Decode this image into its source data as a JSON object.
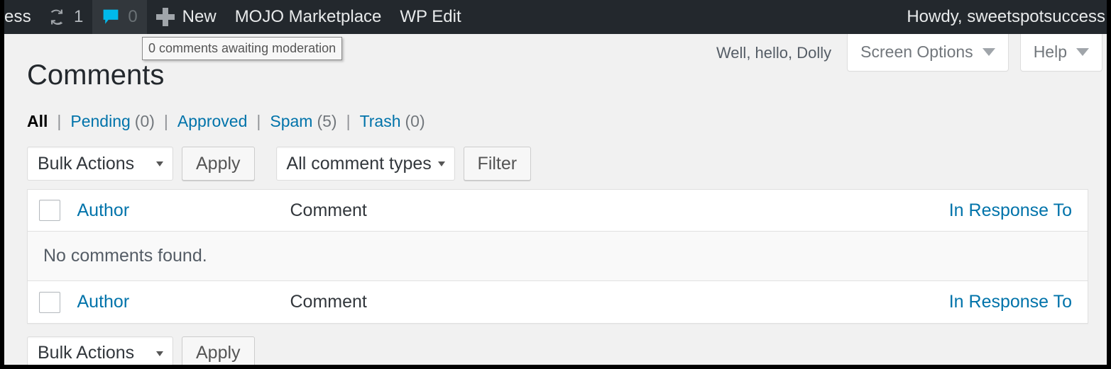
{
  "adminbar": {
    "site_name": "ess",
    "updates": {
      "icon": "update-icon",
      "count": "1"
    },
    "comments": {
      "icon": "comment-bubble-icon",
      "count": "0"
    },
    "new": {
      "icon": "plus-icon",
      "label": "New"
    },
    "mojo_marketplace": "MOJO Marketplace",
    "wp_edit": "WP Edit",
    "howdy": "Howdy, sweetspotsuccess",
    "bubble_color": "#00b9eb",
    "bar_color": "#23282d",
    "hover_color": "#32373c"
  },
  "tooltip": {
    "text": "0 comments awaiting moderation"
  },
  "screen_meta": {
    "dolly": "Well, hello, Dolly",
    "screen_options": "Screen Options",
    "help": "Help"
  },
  "page": {
    "title": "Comments"
  },
  "filters": {
    "items": [
      {
        "label": "All",
        "count": "",
        "current": true
      },
      {
        "label": "Pending",
        "count": "(0)",
        "current": false
      },
      {
        "label": "Approved",
        "count": "",
        "current": false
      },
      {
        "label": "Spam",
        "count": "(5)",
        "current": false
      },
      {
        "label": "Trash",
        "count": "(0)",
        "current": false
      }
    ],
    "separator": "|"
  },
  "tablenav_top": {
    "bulk_actions_value": "Bulk Actions",
    "apply_label": "Apply",
    "comment_types_value": "All comment types",
    "filter_label": "Filter"
  },
  "tablenav_bottom": {
    "bulk_actions_value": "Bulk Actions",
    "apply_label": "Apply"
  },
  "table": {
    "columns": {
      "author": "Author",
      "comment": "Comment",
      "response": "In Response To"
    },
    "no_items": "No comments found."
  },
  "colors": {
    "link": "#0073aa",
    "page_bg": "#f1f1f1",
    "border": "#e1e1e1"
  }
}
